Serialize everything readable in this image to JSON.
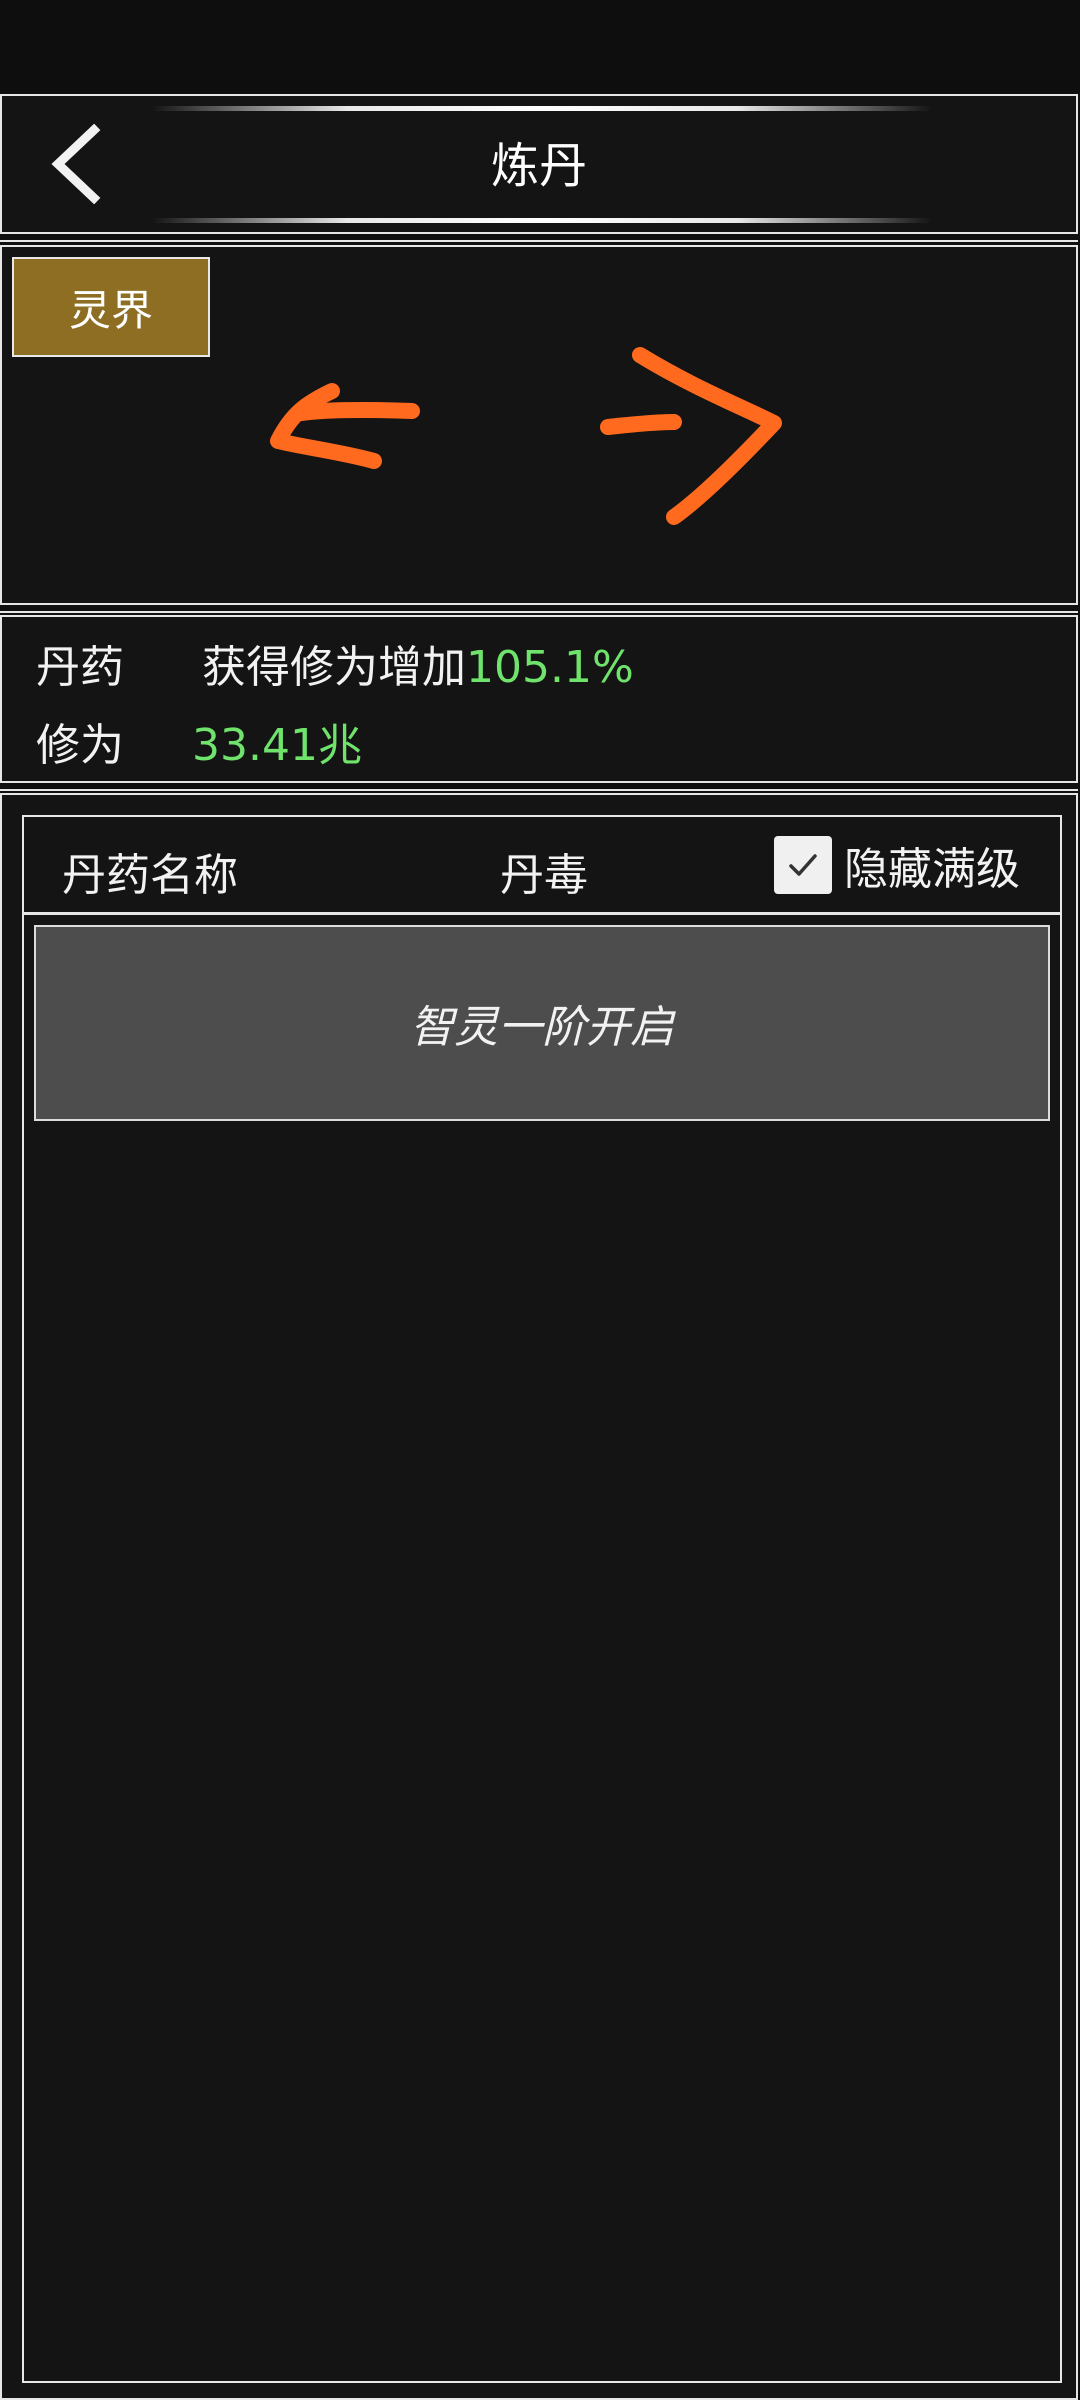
{
  "header": {
    "title": "炼丹",
    "back_icon": "chevron-left-icon"
  },
  "realm": {
    "tab_label": "灵界",
    "arrow_color": "#ff6a1f",
    "left_arrow_icon": "arrow-left-icon",
    "right_arrow_icon": "arrow-right-icon"
  },
  "info": {
    "pill_label": "丹药",
    "pill_text": "获得修为增加",
    "pill_value": "105.1%",
    "cultivation_label": "修为",
    "cultivation_value": "33.41兆"
  },
  "list": {
    "col_name": "丹药名称",
    "col_toxicity": "丹毒",
    "hide_max_label": "隐藏满级",
    "hide_max_checked": true,
    "unlock_text": "智灵一阶开启"
  },
  "colors": {
    "accent_gold": "#8d6e22",
    "value_green": "#6fe36b"
  }
}
